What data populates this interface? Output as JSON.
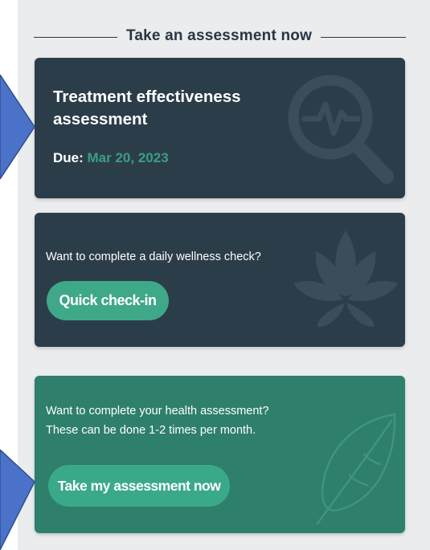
{
  "header": {
    "title": "Take an assessment now"
  },
  "assessment_card": {
    "title": "Treatment effectiveness assessment",
    "due_label": "Due:",
    "due_date": "Mar 20, 2023",
    "icon": "magnifier-heartbeat-icon"
  },
  "wellness_card": {
    "prompt": "Want to complete a daily wellness check?",
    "button_label": "Quick check-in",
    "icon": "lotus-icon"
  },
  "health_card": {
    "prompt_line1": "Want to complete your health assessment?",
    "prompt_line2": "These can be done 1-2 times per month.",
    "button_label": "Take my assessment now",
    "icon": "leaf-icon"
  },
  "colors": {
    "dark_card": "#2c3d4a",
    "green_card": "#2e7f6b",
    "accent": "#3ea889",
    "pointer_arrow": "#4a72c8"
  }
}
